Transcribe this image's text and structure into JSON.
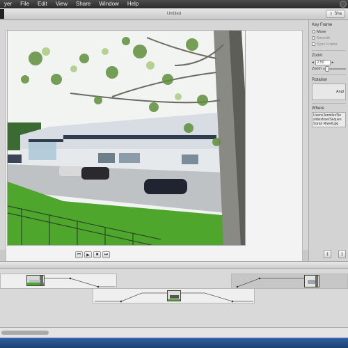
{
  "menubar": {
    "items": [
      {
        "label": "yer"
      },
      {
        "label": "File"
      },
      {
        "label": "Edit"
      },
      {
        "label": "View"
      },
      {
        "label": "Share"
      },
      {
        "label": "Window"
      },
      {
        "label": "Help"
      }
    ]
  },
  "window": {
    "title": "Untitled",
    "share_label": "Sha"
  },
  "inspector": {
    "keyframe": {
      "title": "Key Frame",
      "options": [
        "Move",
        "Smooth",
        "Sync Frame"
      ]
    },
    "zoom": {
      "title": "Zoom",
      "value": "2.50",
      "level_fraction": 0.1,
      "row_label": "Zoom"
    },
    "rotation": {
      "title": "Rotation",
      "angle_label": "Angl"
    },
    "where": {
      "title": "Where",
      "path": "Users/Jennifer/De\nslideshow/Sequen\nSuran Riwell.jpg"
    }
  },
  "transport": {
    "buttons": [
      {
        "icon": "previous-icon",
        "glyph": "⏮"
      },
      {
        "icon": "play-icon",
        "glyph": "▶"
      },
      {
        "icon": "stop-icon",
        "glyph": "■"
      },
      {
        "icon": "next-icon",
        "glyph": "⏭"
      }
    ]
  },
  "corner_buttons": [
    {
      "icon": "import-icon",
      "glyph": "↧"
    },
    {
      "icon": "export-icon",
      "glyph": "↥"
    }
  ],
  "colors": {
    "grass": "#4fa62c",
    "sky": "#f2f4f2",
    "building": "#d7dde2",
    "dock": "#1d3f73"
  }
}
